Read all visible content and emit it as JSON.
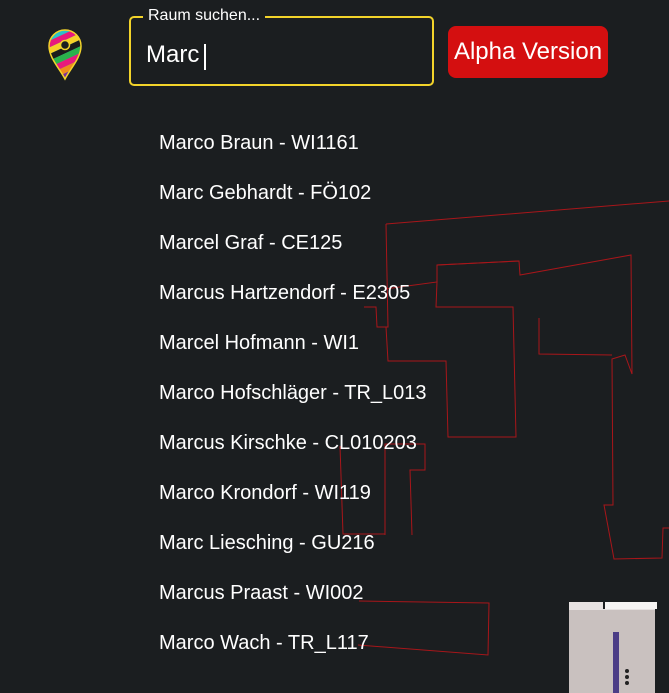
{
  "header": {
    "logo_icon": "map-pin-logo-icon",
    "search": {
      "label": "Raum suchen...",
      "value": "Marc"
    },
    "badge_label": "Alpha Version"
  },
  "results": [
    "Marco Braun - WI1161",
    "Marc Gebhardt - FÖ102",
    "Marcel Graf - CE125",
    "Marcus Hartzendorf - E2305",
    "Marcel Hofmann - WI1",
    "Marco Hofschläger - TR_L013",
    "Marcus Kirschke - CL010203",
    "Marco Krondorf - WI119",
    "Marc Liesching - GU216",
    "Marcus Praast - WI002",
    "Marco Wach - TR_L117"
  ],
  "colors": {
    "background": "#1b1e20",
    "search_border": "#f2d32a",
    "badge": "#d40f10",
    "map_outline": "#b0161a"
  },
  "floor_widget": {
    "menu_icon": "vertical-dots-icon"
  }
}
